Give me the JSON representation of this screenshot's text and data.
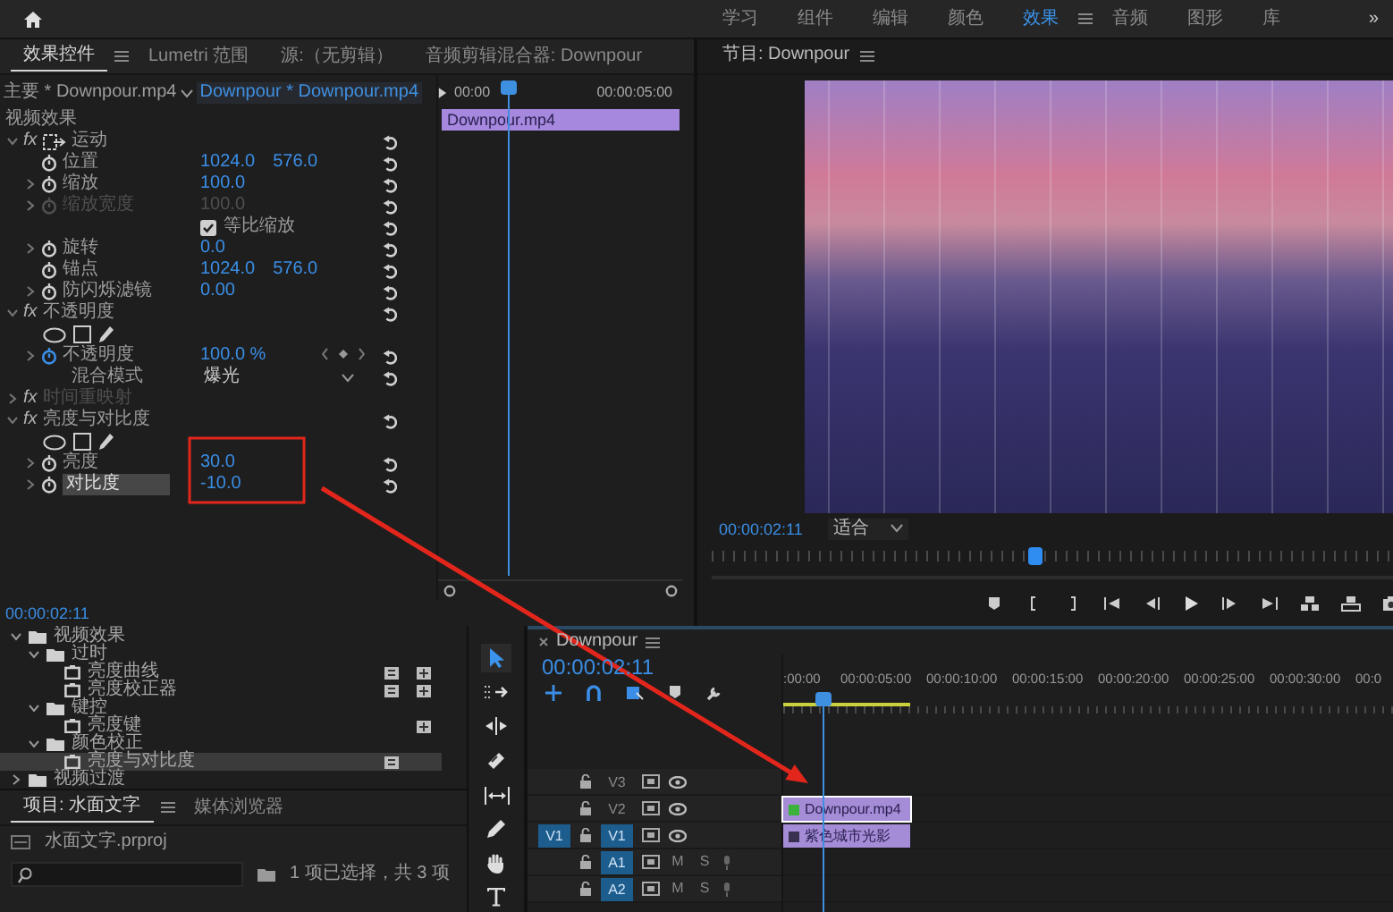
{
  "workspace_tabs": [
    {
      "label": "学习",
      "selected": false
    },
    {
      "label": "组件",
      "selected": false
    },
    {
      "label": "编辑",
      "selected": false
    },
    {
      "label": "颜色",
      "selected": false
    },
    {
      "label": "效果",
      "selected": true
    },
    {
      "label": "音频",
      "selected": false
    },
    {
      "label": "图形",
      "selected": false
    },
    {
      "label": "库",
      "selected": false
    }
  ],
  "workspace_overflow": "»",
  "effect_controls": {
    "tabs": [
      {
        "label": "效果控件",
        "selected": true
      },
      {
        "label": "Lumetri 范围",
        "selected": false
      },
      {
        "label": "源:（无剪辑）",
        "selected": false
      },
      {
        "label": "音频剪辑混合器: Downpour",
        "selected": false
      }
    ],
    "master_clip": "主要 * Downpour.mp4",
    "sequence_clip": "Downpour * Downpour.mp4",
    "section_label": "视频效果",
    "effects": [
      {
        "name": "运动",
        "fx": "fx",
        "kind": "motion",
        "expanded": true,
        "disabled": false,
        "params": [
          {
            "kind": "param",
            "label": "位置",
            "values": [
              "1024.0",
              "576.0"
            ],
            "animated": false,
            "disabled": false
          },
          {
            "kind": "param",
            "label": "缩放",
            "expanded": false,
            "values": [
              "100.0"
            ],
            "animated": false,
            "disabled": false
          },
          {
            "kind": "param",
            "label": "缩放宽度",
            "expanded": false,
            "values": [
              "100.0"
            ],
            "animated": false,
            "disabled": true
          },
          {
            "kind": "checkbox",
            "label": "等比缩放",
            "checked": true
          },
          {
            "kind": "param",
            "label": "旋转",
            "expanded": false,
            "values": [
              "0.0"
            ],
            "animated": false,
            "disabled": false
          },
          {
            "kind": "param",
            "label": "锚点",
            "values": [
              "1024.0",
              "576.0"
            ],
            "animated": false,
            "disabled": false
          },
          {
            "kind": "param",
            "label": "防闪烁滤镜",
            "expanded": false,
            "values": [
              "0.00"
            ],
            "animated": false,
            "disabled": false
          }
        ]
      },
      {
        "name": "不透明度",
        "fx": "fx",
        "kind": "opacity",
        "expanded": true,
        "disabled": false,
        "params": [
          {
            "kind": "masks"
          },
          {
            "kind": "param",
            "label": "不透明度",
            "expanded": false,
            "values": [
              "100.0 %"
            ],
            "animated": true,
            "keyframes": true,
            "disabled": false
          },
          {
            "kind": "dropdown",
            "label": "混合模式",
            "value": "爆光"
          }
        ]
      },
      {
        "name": "时间重映射",
        "fx": "fx",
        "kind": "time_remap",
        "expanded": false,
        "disabled": true
      },
      {
        "name": "亮度与对比度",
        "fx": "fx",
        "kind": "filter",
        "expanded": true,
        "disabled": false,
        "annotated": true,
        "params": [
          {
            "kind": "masks"
          },
          {
            "kind": "param",
            "label": "亮度",
            "expanded": false,
            "values": [
              "30.0"
            ],
            "animated": false,
            "disabled": false
          },
          {
            "kind": "param",
            "label": "对比度",
            "expanded": false,
            "values": [
              "-10.0"
            ],
            "animated": false,
            "disabled": false,
            "focused": true
          }
        ]
      }
    ],
    "ruler": [
      "00:00",
      "00:00:05:00"
    ],
    "clip": "Downpour.mp4",
    "timecode": "00:00:02:11"
  },
  "effects_panel": [
    {
      "label": "视频效果",
      "expanded": true,
      "children": [
        {
          "label": "过时",
          "expanded": true,
          "children": [
            {
              "label": "亮度曲线",
              "selected": false,
              "accelerated": true,
              "color_32bit": true
            },
            {
              "label": "亮度校正器",
              "selected": false,
              "accelerated": true,
              "color_32bit": true
            }
          ]
        },
        {
          "label": "键控",
          "expanded": true,
          "children": [
            {
              "label": "亮度键",
              "selected": false,
              "accelerated": false,
              "color_32bit": true
            }
          ]
        },
        {
          "label": "颜色校正",
          "expanded": true,
          "children": [
            {
              "label": "亮度与对比度",
              "selected": true,
              "accelerated": true,
              "color_32bit": false
            }
          ]
        }
      ]
    },
    {
      "label": "视频过渡",
      "expanded": false
    }
  ],
  "project": {
    "tabs": [
      {
        "label": "项目: 水面文字",
        "selected": true
      },
      {
        "label": "媒体浏览器",
        "selected": false
      }
    ],
    "file": "水面文字.prproj",
    "selection": "1 项已选择，共 3 项"
  },
  "tools": [
    {
      "kind": "selection",
      "selected": true
    },
    {
      "kind": "track_select",
      "selected": false
    },
    {
      "kind": "ripple",
      "selected": false
    },
    {
      "kind": "razor",
      "selected": false
    },
    {
      "kind": "slip",
      "selected": false
    },
    {
      "kind": "pen",
      "selected": false
    },
    {
      "kind": "hand",
      "selected": false
    },
    {
      "kind": "type",
      "selected": false
    }
  ],
  "monitor": {
    "title": "节目: Downpour",
    "timecode": "00:00:02:11",
    "fit": "适合"
  },
  "timeline": {
    "tab": "Downpour",
    "timecode": "00:00:02:11",
    "ruler": [
      ":00:00",
      "00:00:05:00",
      "00:00:10:00",
      "00:00:15:00",
      "00:00:20:00",
      "00:00:25:00",
      "00:00:30:00",
      "00:0"
    ],
    "tracks": [
      {
        "name": "V3",
        "kind": "video",
        "targeted": false
      },
      {
        "name": "V2",
        "kind": "video",
        "targeted": false,
        "clip": {
          "label": "Downpour.mp4",
          "selected": true,
          "fx_applied": true
        }
      },
      {
        "name": "V1",
        "kind": "video",
        "targeted": true,
        "source": "V1",
        "clip": {
          "label": "紫色城市光影",
          "selected": false,
          "fx_applied": false
        }
      },
      {
        "name": "A1",
        "kind": "audio",
        "targeted": true,
        "mute": "M",
        "solo": "S"
      },
      {
        "name": "A2",
        "kind": "audio",
        "targeted": true,
        "mute": "M",
        "solo": "S"
      }
    ]
  }
}
